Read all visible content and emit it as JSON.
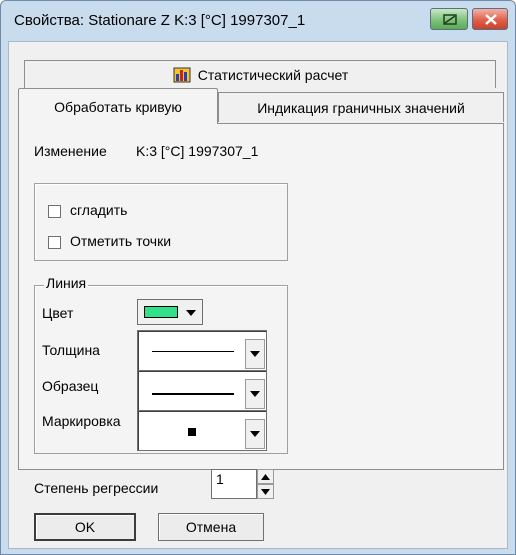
{
  "window": {
    "title": "Свойства: Stationare Z K:3 [°C] 1997307_1"
  },
  "tabs": [
    {
      "label": "Статистический расчет"
    },
    {
      "label": "Обработать кривую"
    },
    {
      "label": "Индикация граничных значений"
    }
  ],
  "change": {
    "label": "Изменение",
    "value": "K:3 [°C] 1997307_1"
  },
  "options": {
    "smooth_label": "сгладить",
    "smooth_checked": false,
    "mark_points_label": "Отметить точки",
    "mark_points_checked": false
  },
  "line": {
    "legend": "Линия",
    "color_label": "Цвет",
    "color": "#33e08a",
    "thickness_label": "Толщина",
    "pattern_label": "Образец",
    "marking_label": "Маркировка"
  },
  "regression": {
    "label": "Степень регрессии",
    "value": "1"
  },
  "buttons": {
    "ok": "OK",
    "cancel": "Отмена"
  }
}
